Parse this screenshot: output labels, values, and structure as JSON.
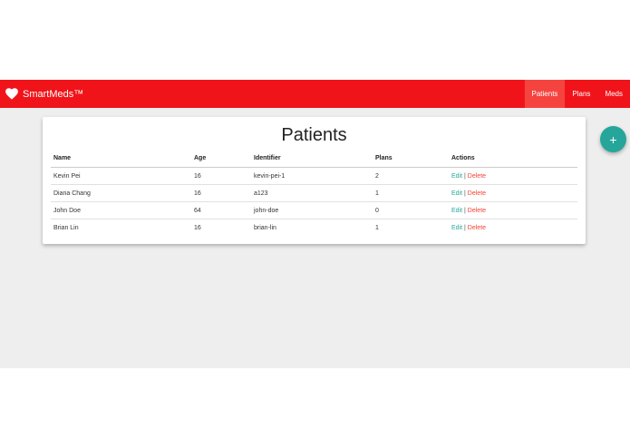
{
  "navbar": {
    "brand": "SmartMeds™",
    "brand_icon": "heart-icon",
    "links": [
      "Patients",
      "Plans",
      "Meds"
    ],
    "active_link": "Patients",
    "color": "#f0141a"
  },
  "main": {
    "title": "Patients",
    "columns": [
      "Name",
      "Age",
      "Identifier",
      "Plans",
      "Actions"
    ],
    "rows": [
      {
        "name": "Kevin Pei",
        "age": "16",
        "identifier": "kevin-pei-1",
        "plans": "2",
        "edit": "Edit",
        "sep": "|",
        "delete": "Delete"
      },
      {
        "name": "Diana Chang",
        "age": "16",
        "identifier": "a123",
        "plans": "1",
        "edit": "Edit",
        "sep": "|",
        "delete": "Delete"
      },
      {
        "name": "John Doe",
        "age": "64",
        "identifier": "john-doe",
        "plans": "0",
        "edit": "Edit",
        "sep": "|",
        "delete": "Delete"
      },
      {
        "name": "Brian Lin",
        "age": "16",
        "identifier": "brian-lin",
        "plans": "1",
        "edit": "Edit",
        "sep": "|",
        "delete": "Delete"
      }
    ]
  },
  "fab": {
    "label": "+",
    "icon": "plus-icon",
    "color": "#26a69a"
  },
  "colors": {
    "edit": "#26a69a",
    "delete": "#f44336",
    "background": "#eeeeee"
  }
}
